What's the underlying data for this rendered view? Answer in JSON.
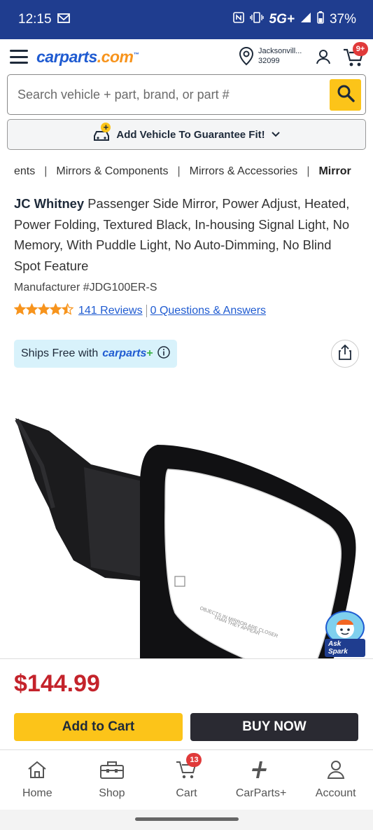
{
  "status": {
    "time": "12:15",
    "battery": "37%",
    "network": "5G+"
  },
  "header": {
    "logo_main": "carparts",
    "logo_dot": ".com",
    "logo_tm": "™",
    "location_city": "Jacksonvill...",
    "location_zip": "32099",
    "cart_badge": "9+"
  },
  "search": {
    "placeholder": "Search vehicle + part, brand, or part #"
  },
  "add_vehicle": {
    "label": "Add Vehicle To Guarantee Fit!"
  },
  "breadcrumbs": [
    "ents",
    "Mirrors & Components",
    "Mirrors & Accessories",
    "Mirror"
  ],
  "product": {
    "brand": "JC Whitney",
    "title": "Passenger Side Mirror, Power Adjust, Heated, Power Folding, Textured Black, In-housing Signal Light, No Memory, With Puddle Light, No Auto-Dimming, No Blind Spot Feature",
    "manufacturer": "Manufacturer #JDG100ER-S",
    "rating": 4.5,
    "reviews": "141 Reviews",
    "qa": "0 Questions & Answers",
    "ships_prefix": "Ships Free with",
    "ships_brand": "carparts",
    "ships_plus": "+",
    "mirror_text_1": "OBJECTS IN MIRROR ARE CLOSER",
    "mirror_text_2": "THAN THEY APPEAR",
    "price": "$144.99"
  },
  "spark": {
    "label": "Ask Spark"
  },
  "actions": {
    "add_to_cart": "Add to Cart",
    "buy_now": "BUY NOW"
  },
  "tabs": [
    {
      "label": "Home",
      "icon": "home-icon"
    },
    {
      "label": "Shop",
      "icon": "toolbox-icon"
    },
    {
      "label": "Cart",
      "icon": "cart-icon",
      "badge": "13"
    },
    {
      "label": "CarParts+",
      "icon": "carparts-plus-icon"
    },
    {
      "label": "Account",
      "icon": "account-icon"
    }
  ],
  "colors": {
    "brand_blue": "#1f5bd1",
    "status_bar": "#1f3d8f",
    "accent_yellow": "#fcc419",
    "price_red": "#c4232b",
    "star_orange": "#f7941d"
  }
}
